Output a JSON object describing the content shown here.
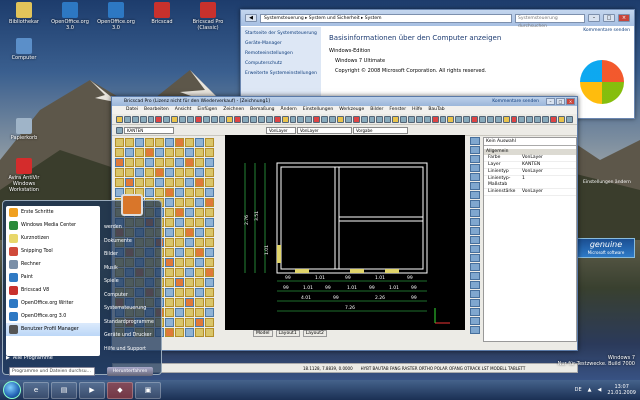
{
  "desktop": {
    "icons": [
      {
        "label": "Bibliothekar",
        "icon": "folder-icon",
        "color": "#e1c45a"
      },
      {
        "label": "OpenOffice.org 3.0",
        "icon": "openoffice-icon",
        "color": "#2d78c3"
      },
      {
        "label": "OpenOffice.org 3.0",
        "icon": "openoffice-icon",
        "color": "#2d78c3"
      },
      {
        "label": "Bricscad",
        "icon": "bricscad-icon",
        "color": "#c8312d"
      },
      {
        "label": "Bricscad Pro (Classic)",
        "icon": "bricscad-icon",
        "color": "#c8312d"
      }
    ],
    "left_icons": [
      {
        "label": "Computer",
        "icon": "computer-icon",
        "color": "#5b8fc9"
      },
      {
        "label": "Papierkorb",
        "icon": "recycle-bin-icon",
        "color": "#9fb4c8"
      },
      {
        "label": "Avira AntiVir Windows Workstation",
        "icon": "avira-icon",
        "color": "#d42c2c"
      }
    ],
    "gadget_genuine": "genuine",
    "gadget_genuine_sub": "Microsoft software",
    "watermark_line1": "Windows 7",
    "watermark_line2": "Nur für Testzwecke. Build 7000"
  },
  "control_panel": {
    "breadcrumb": "Systemsteuerung ▸ System und Sicherheit ▸ System",
    "search_placeholder": "Systemsteuerung durchsuchen",
    "sidebar_links": [
      "Startseite der Systemsteuerung",
      "Geräte-Manager",
      "Remoteeinstellungen",
      "Computerschutz",
      "Erweiterte Systemeinstellungen"
    ],
    "heading": "Basisinformationen über den Computer anzeigen",
    "edition_label": "Windows-Edition",
    "edition": "Windows 7 Ultimate",
    "copyright": "Copyright © 2008 Microsoft Corporation. All rights reserved.",
    "comments_link": "Kommentare senden",
    "settings_link": "Einstellungen ändern"
  },
  "bricscad": {
    "title": "Bricscad Pro (Lizenz nicht für den Wiederverkauf) - [Zeichnung1]",
    "comments_link": "Kommentare senden",
    "menu": [
      "Datei",
      "Bearbeiten",
      "Ansicht",
      "Einfügen",
      "Zeichnen",
      "Bemaßung",
      "Ändern",
      "Einstellungen",
      "Werkzeuge",
      "Bilder",
      "Fenster",
      "Hilfe",
      "BauTab"
    ],
    "layer_select": "KANTEN",
    "bylayer_1": "VonLayer",
    "bylayer_2": "VonLayer",
    "bylayer_3": "Vorgabe",
    "tabs": [
      "Model",
      "Layout1",
      "Layout2"
    ],
    "status_coords": "18.1128, 7.8839, 0.0000",
    "status_flags": "HYBT BAUTAB FANG RASTER ORTHO POLAR OFANG OTRACK LST MODELL TABLETT",
    "props_select": "Kein Auswahl",
    "props_section": "Allgemein",
    "props": [
      {
        "k": "Farbe",
        "v": "VonLayer"
      },
      {
        "k": "Layer",
        "v": "KANTEN"
      },
      {
        "k": "Linientyp",
        "v": "VonLayer"
      },
      {
        "k": "Linientyp-Maßstab",
        "v": "1"
      },
      {
        "k": "Linienstärke",
        "v": "VonLayer"
      }
    ],
    "dims": {
      "top": [
        "99",
        "1.01",
        "99",
        "1.01",
        "99"
      ],
      "row2": [
        "99",
        "1.01",
        "99",
        "1.01",
        "99",
        "1.01",
        "99"
      ],
      "row3": [
        "4.01",
        "99",
        "2.26",
        "99"
      ],
      "total": "7.26",
      "side1": "3.51",
      "side2": "2.76",
      "side3": "1.01"
    }
  },
  "start_menu": {
    "pinned": [
      {
        "label": "Erste Schritte",
        "color": "#f0a020"
      },
      {
        "label": "Windows Media Center",
        "color": "#2a8a3a"
      },
      {
        "label": "Kurznotizen",
        "color": "#e8d76a"
      },
      {
        "label": "Snipping Tool",
        "color": "#d04a3a"
      },
      {
        "label": "Rechner",
        "color": "#7a8fa8"
      },
      {
        "label": "Paint",
        "color": "#2f7ac4"
      },
      {
        "label": "Bricscad V8",
        "color": "#c8312d"
      },
      {
        "label": "OpenOffice.org Writer",
        "color": "#2d78c3"
      },
      {
        "label": "OpenOffice.org 3.0",
        "color": "#2d78c3"
      },
      {
        "label": "Benutzer Profil Manager",
        "color": "#555555"
      }
    ],
    "all_programs": "Alle Programme",
    "search_placeholder": "Programme und Dateien durchsu...",
    "right": [
      "werden",
      "Dokumente",
      "Bilder",
      "Musik",
      "Spiele",
      "Computer",
      "Systemsteuerung",
      "Standardprogramme",
      "Geräte und Drucker",
      "Hilfe und Support"
    ],
    "shutdown": "Herunterfahren"
  },
  "taskbar": {
    "lang": "DE",
    "time": "13:07",
    "date": "21.01.2009"
  }
}
